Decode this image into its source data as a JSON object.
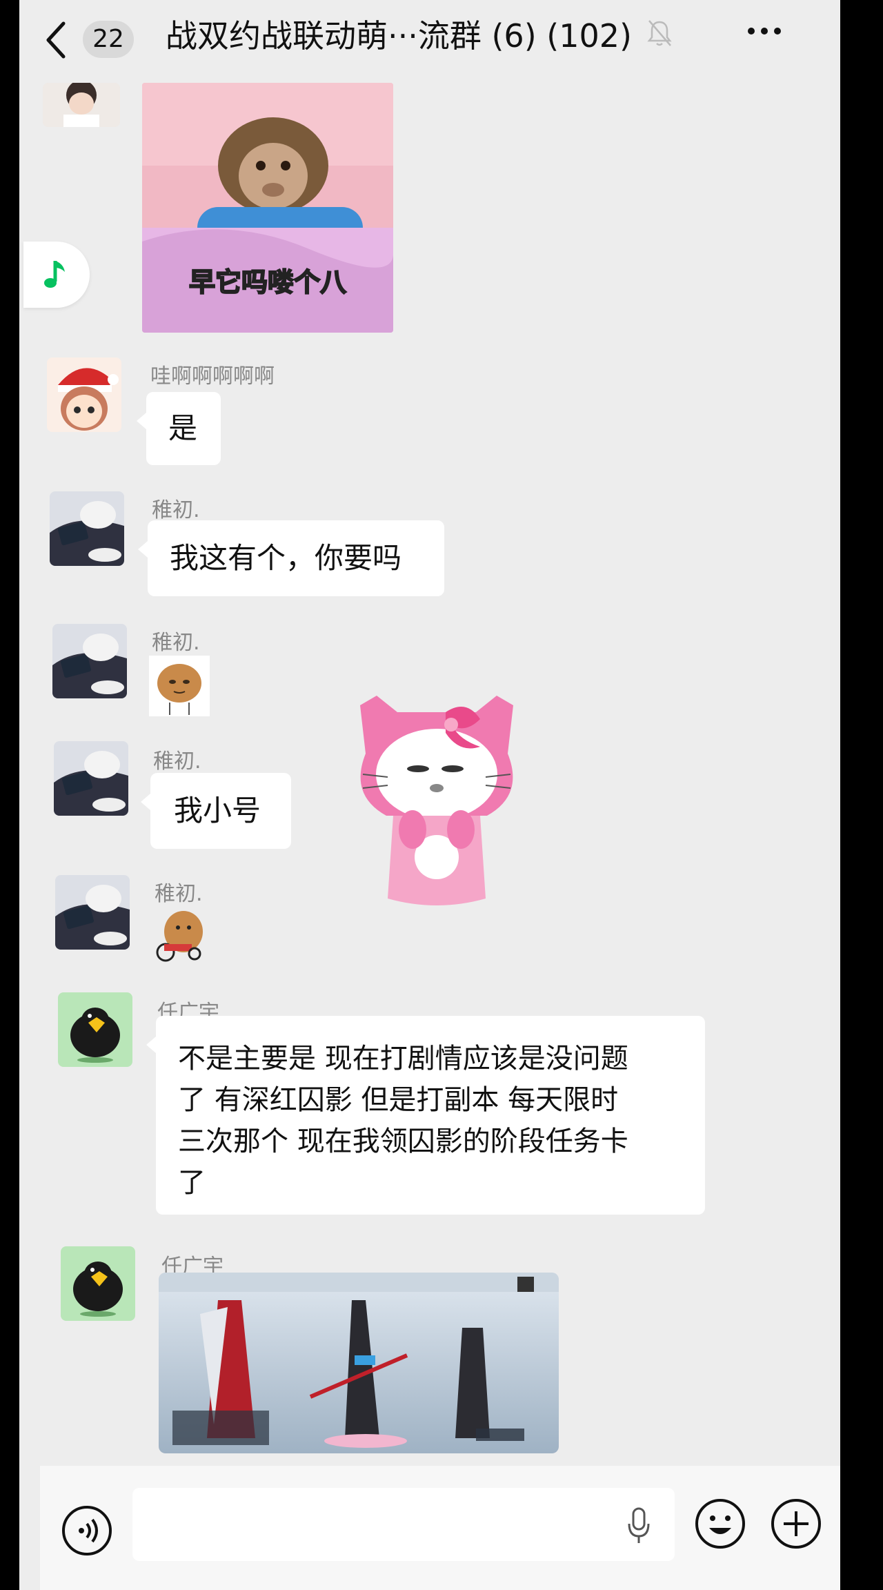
{
  "header": {
    "unread_count": "22",
    "title": "战双约战联动萌···流群 (6) (102)",
    "muted_icon": "bell-muted-icon",
    "more_icon": "more-dots-icon"
  },
  "messages": [
    {
      "sender": "",
      "type": "image",
      "image_caption": "早它吗喽个八"
    },
    {
      "sender": "哇啊啊啊啊啊",
      "type": "text",
      "text": "是"
    },
    {
      "sender": "稚初.",
      "type": "text",
      "text": "我这有个，你要吗"
    },
    {
      "sender": "稚初.",
      "type": "sticker",
      "sticker": "cat-sticker"
    },
    {
      "sender": "稚初.",
      "type": "text",
      "text": "我小号"
    },
    {
      "sender": "稚初.",
      "type": "sticker",
      "sticker": "hamster-sticker"
    },
    {
      "sender": "任广宇",
      "type": "text",
      "lines": [
        "不是主要是 现在打剧情应该是没问题",
        "了 有深红囚影  但是打副本 每天限时",
        "三次那个 现在我领囚影的阶段任务卡",
        "了"
      ]
    },
    {
      "sender": "任广宇",
      "type": "image",
      "image": "game-screenshot"
    }
  ],
  "floating_sticker": "hello-kitty-sticker",
  "floating_music_icon": "music-note-icon",
  "input_bar": {
    "voice_icon": "voice-icon",
    "mic_icon": "mic-icon",
    "emoji_icon": "emoji-icon",
    "plus_icon": "plus-icon"
  },
  "colors": {
    "chat_bg": "#ededed",
    "bubble": "#ffffff",
    "sender_text": "#888888",
    "music_green": "#07c160",
    "kitty_pink": "#f07ab0"
  }
}
